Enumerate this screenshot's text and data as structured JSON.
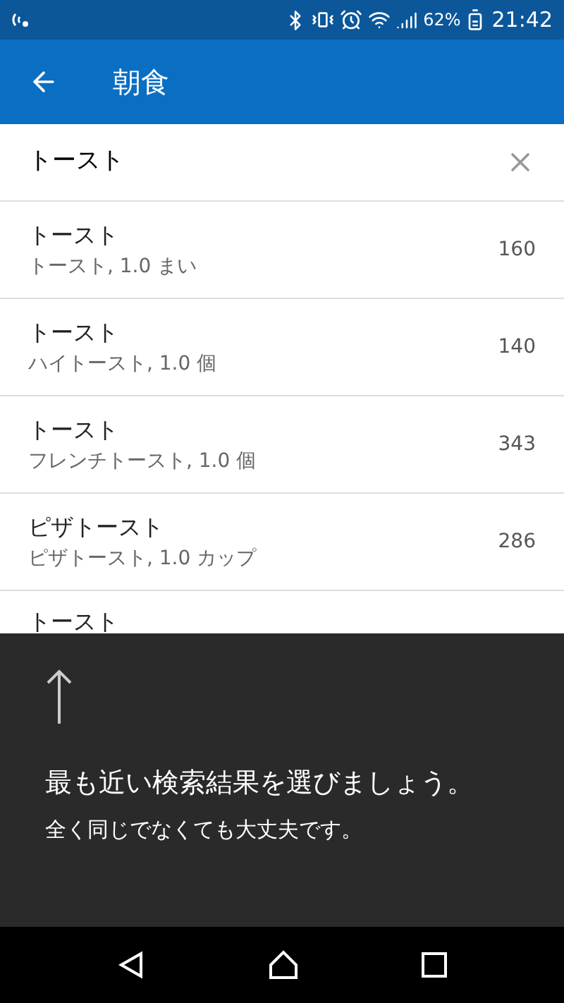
{
  "status_bar": {
    "battery": "62%",
    "time": "21:42"
  },
  "app_bar": {
    "title": "朝食"
  },
  "search": {
    "value": "トースト"
  },
  "results": [
    {
      "name": "トースト",
      "detail": "トースト, 1.0 まい",
      "calories": "160"
    },
    {
      "name": "トースト",
      "detail": "ハイトースト, 1.0 個",
      "calories": "140"
    },
    {
      "name": "トースト",
      "detail": "フレンチトースト, 1.0 個",
      "calories": "343"
    },
    {
      "name": "ピザトースト",
      "detail": "ピザトースト, 1.0 カップ",
      "calories": "286"
    },
    {
      "name": "トースト"
    }
  ],
  "tip": {
    "title": "最も近い検索結果を選びましょう。",
    "body": "全く同じでなくても大丈夫です。"
  }
}
